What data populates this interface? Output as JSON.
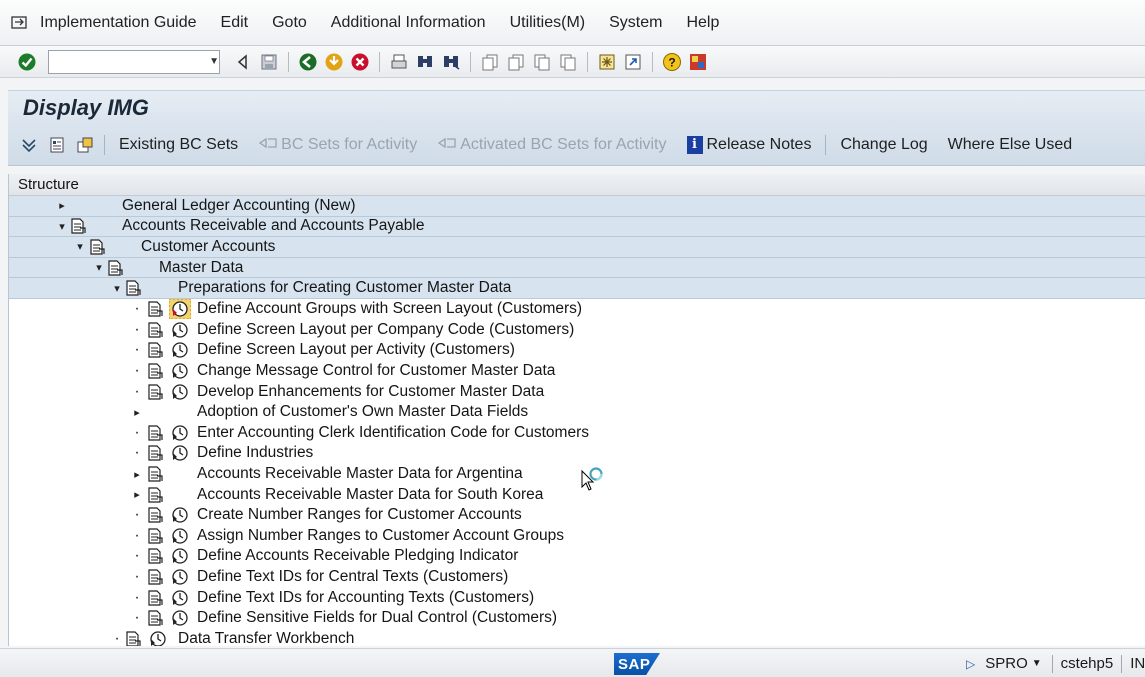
{
  "menu": {
    "items": [
      "Implementation Guide",
      "Edit",
      "Goto",
      "Additional Information",
      "Utilities(M)",
      "System",
      "Help"
    ]
  },
  "toolbar": {
    "command_field_value": "",
    "icons": [
      "enter-icon",
      "back-icon",
      "save-icon",
      "green-back-icon",
      "exit-icon",
      "cancel-icon",
      "print-icon",
      "find-icon",
      "find-next-icon",
      "first-page-icon",
      "previous-page-icon",
      "next-page-icon",
      "last-page-icon",
      "create-session-icon",
      "generate-shortcut-icon",
      "help-icon",
      "customize-layout-icon"
    ]
  },
  "title": "Display IMG",
  "app_toolbar": {
    "existing_bc_sets": "Existing BC Sets",
    "bc_sets_for_activity": "BC Sets for Activity",
    "activated_bc_sets": "Activated BC Sets for Activity",
    "release_notes": "Release Notes",
    "change_log": "Change Log",
    "where_else_used": "Where Else Used"
  },
  "tree": {
    "header": "Structure",
    "rows": [
      {
        "label": "General Ledger Accounting (New)",
        "level": 0,
        "toggle": "collapsed",
        "doc": false,
        "clock": false,
        "highlight": true
      },
      {
        "label": "Accounts Receivable and Accounts Payable",
        "level": 0,
        "toggle": "expanded",
        "doc": true,
        "clock": false,
        "highlight": true
      },
      {
        "label": "Customer Accounts",
        "level": 1,
        "toggle": "expanded",
        "doc": true,
        "clock": false,
        "highlight": true
      },
      {
        "label": "Master Data",
        "level": 2,
        "toggle": "expanded",
        "doc": true,
        "clock": false,
        "highlight": true
      },
      {
        "label": "Preparations for Creating Customer Master Data",
        "level": 3,
        "toggle": "expanded",
        "doc": true,
        "clock": false,
        "highlight": true
      },
      {
        "label": "Define Account Groups with Screen Layout (Customers)",
        "level": 4,
        "toggle": "leaf",
        "doc": true,
        "clock": "selected",
        "highlight": false
      },
      {
        "label": "Define Screen Layout per Company Code (Customers)",
        "level": 4,
        "toggle": "leaf",
        "doc": true,
        "clock": true,
        "highlight": false
      },
      {
        "label": "Define Screen Layout per Activity (Customers)",
        "level": 4,
        "toggle": "leaf",
        "doc": true,
        "clock": true,
        "highlight": false
      },
      {
        "label": "Change Message Control for Customer Master Data",
        "level": 4,
        "toggle": "leaf",
        "doc": true,
        "clock": true,
        "highlight": false
      },
      {
        "label": "Develop Enhancements for Customer Master Data",
        "level": 4,
        "toggle": "leaf",
        "doc": true,
        "clock": true,
        "highlight": false
      },
      {
        "label": "Adoption of Customer's Own Master Data Fields",
        "level": 4,
        "toggle": "collapsed",
        "doc": false,
        "clock": false,
        "highlight": false
      },
      {
        "label": "Enter Accounting Clerk Identification Code for Customers",
        "level": 4,
        "toggle": "leaf",
        "doc": true,
        "clock": true,
        "highlight": false
      },
      {
        "label": "Define Industries",
        "level": 4,
        "toggle": "leaf",
        "doc": true,
        "clock": true,
        "highlight": false
      },
      {
        "label": "Accounts Receivable Master Data for Argentina",
        "level": 4,
        "toggle": "collapsed",
        "doc": true,
        "clock": false,
        "highlight": false
      },
      {
        "label": "Accounts Receivable Master Data for South Korea",
        "level": 4,
        "toggle": "collapsed",
        "doc": true,
        "clock": false,
        "highlight": false
      },
      {
        "label": "Create Number Ranges for Customer Accounts",
        "level": 4,
        "toggle": "leaf",
        "doc": true,
        "clock": true,
        "highlight": false
      },
      {
        "label": "Assign Number Ranges to Customer Account Groups",
        "level": 4,
        "toggle": "leaf",
        "doc": true,
        "clock": true,
        "highlight": false
      },
      {
        "label": "Define Accounts Receivable Pledging Indicator",
        "level": 4,
        "toggle": "leaf",
        "doc": true,
        "clock": true,
        "highlight": false
      },
      {
        "label": "Define Text IDs for Central Texts (Customers)",
        "level": 4,
        "toggle": "leaf",
        "doc": true,
        "clock": true,
        "highlight": false
      },
      {
        "label": "Define Text IDs for Accounting Texts (Customers)",
        "level": 4,
        "toggle": "leaf",
        "doc": true,
        "clock": true,
        "highlight": false
      },
      {
        "label": "Define Sensitive Fields for Dual Control (Customers)",
        "level": 4,
        "toggle": "leaf",
        "doc": true,
        "clock": true,
        "highlight": false
      },
      {
        "label": "Data Transfer Workbench",
        "level": 3,
        "toggle": "leaf",
        "doc": true,
        "clock": true,
        "highlight": false
      }
    ]
  },
  "status": {
    "logo": "SAP",
    "transaction": "SPRO",
    "host": "cstehp5",
    "mode": "INS"
  },
  "colors": {
    "accent_blue": "#1a3fa0",
    "highlight_row": "#d7e4f0",
    "sap_blue": "#0a4fa3"
  }
}
